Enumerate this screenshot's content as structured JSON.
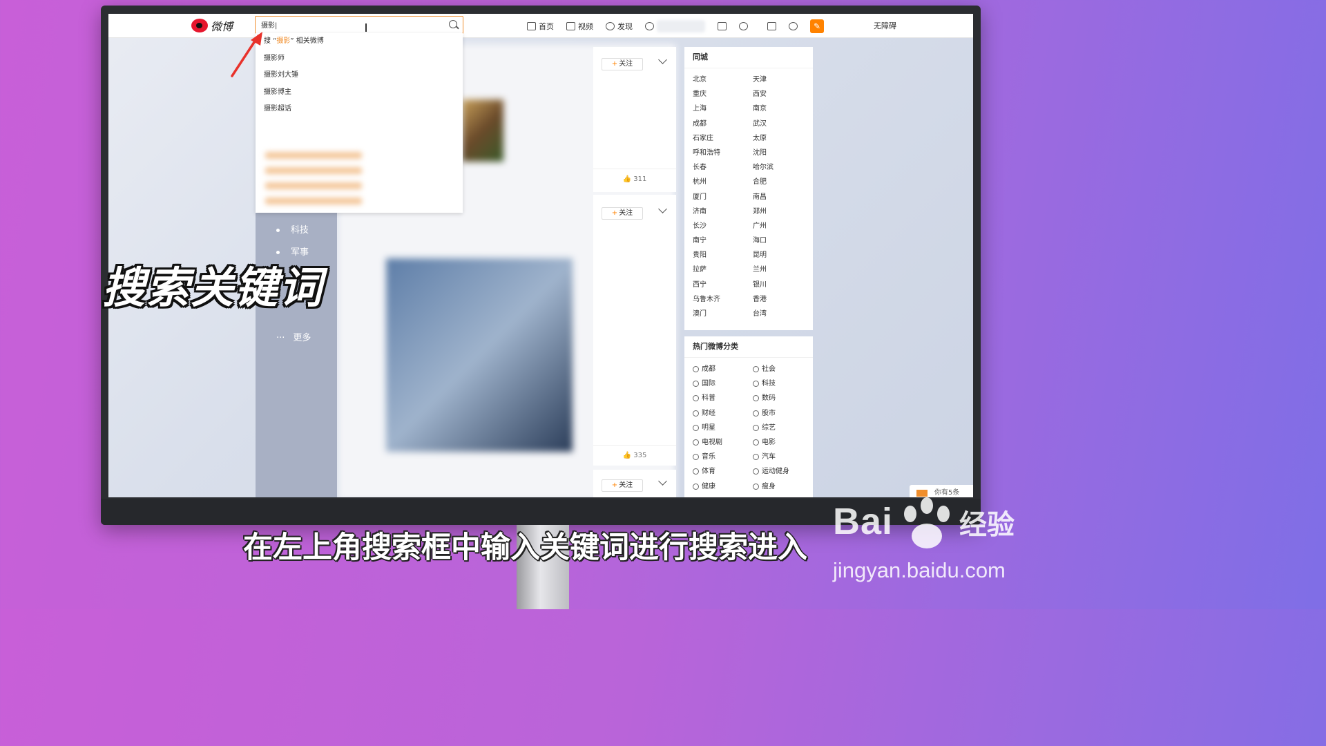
{
  "app": {
    "logo_text": "微博"
  },
  "search": {
    "value": "摄影|"
  },
  "nav": {
    "home": "首页",
    "video": "视频",
    "discover": "发现",
    "accessibility": "无障碍"
  },
  "dropdown": {
    "first": {
      "prefix": "搜 “",
      "keyword": "摄影",
      "suffix": "” 相关微博"
    },
    "items": [
      "摄影师",
      "摄影刘大锤",
      "摄影博主",
      "摄影超话"
    ]
  },
  "leftnav": {
    "items": [
      "科技",
      "军事",
      "时尚"
    ],
    "more": "更多"
  },
  "feed": {
    "follow_label": "关注",
    "likes": [
      "311",
      "335"
    ]
  },
  "city_panel": {
    "title": "同城",
    "cities": [
      "北京",
      "天津",
      "重庆",
      "西安",
      "上海",
      "南京",
      "成都",
      "武汉",
      "石家庄",
      "太原",
      "呼和浩特",
      "沈阳",
      "长春",
      "哈尔滨",
      "杭州",
      "合肥",
      "厦门",
      "南昌",
      "济南",
      "郑州",
      "长沙",
      "广州",
      "南宁",
      "海口",
      "贵阳",
      "昆明",
      "拉萨",
      "兰州",
      "西宁",
      "银川",
      "乌鲁木齐",
      "香港",
      "澳门",
      "台湾"
    ]
  },
  "hot_panel": {
    "title": "热门微博分类",
    "categories": [
      "成都",
      "社会",
      "国际",
      "科技",
      "科普",
      "数码",
      "财经",
      "股市",
      "明星",
      "综艺",
      "电视剧",
      "电影",
      "音乐",
      "汽车",
      "体育",
      "运动健身",
      "健康",
      "瘦身"
    ]
  },
  "message_tab": "你有5条",
  "overlay": {
    "caption": "搜索关键词",
    "subtitle": "在左上角搜索框中输入关键词进行搜索进入"
  },
  "watermark": {
    "brand": "Bai",
    "brand2": "经验",
    "url": "jingyan.baidu.com"
  },
  "colors": {
    "accent": "#f08e2c",
    "weibo_red": "#e6162d",
    "background_left": "#c85fd8",
    "background_right": "#7f6ee6"
  }
}
